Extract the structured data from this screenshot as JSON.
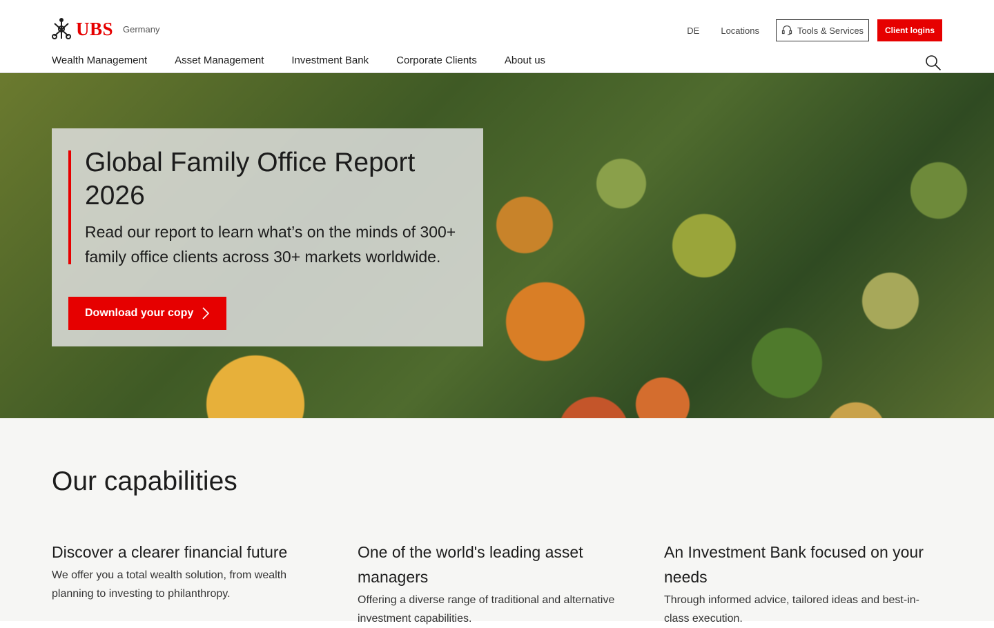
{
  "brand": {
    "name": "UBS",
    "country": "Germany",
    "accent": "#e60000"
  },
  "utility": {
    "lang": "DE",
    "locations": "Locations",
    "tools": "Tools & Services",
    "login": "Client logins"
  },
  "nav": {
    "items": [
      {
        "label": "Wealth Management"
      },
      {
        "label": "Asset Management"
      },
      {
        "label": "Investment Bank"
      },
      {
        "label": "Corporate Clients"
      },
      {
        "label": "About us"
      }
    ]
  },
  "hero": {
    "title": "Global Family Office Report 2026",
    "text": "Read our report to learn what’s on the minds of 300+ family office clients across 30+ markets worldwide.",
    "cta": "Download your copy"
  },
  "capabilities": {
    "title": "Our capabilities",
    "items": [
      {
        "title": "Discover a clearer financial future",
        "text": "We offer you a total wealth solution, from wealth planning to investing to philanthropy."
      },
      {
        "title": "One of the world's leading asset managers",
        "text": "Offering a diverse range of traditional and alternative investment capabilities."
      },
      {
        "title": "An Investment Bank focused on your needs",
        "text": "Through informed advice, tailored ideas and best-in-class execution."
      }
    ]
  }
}
